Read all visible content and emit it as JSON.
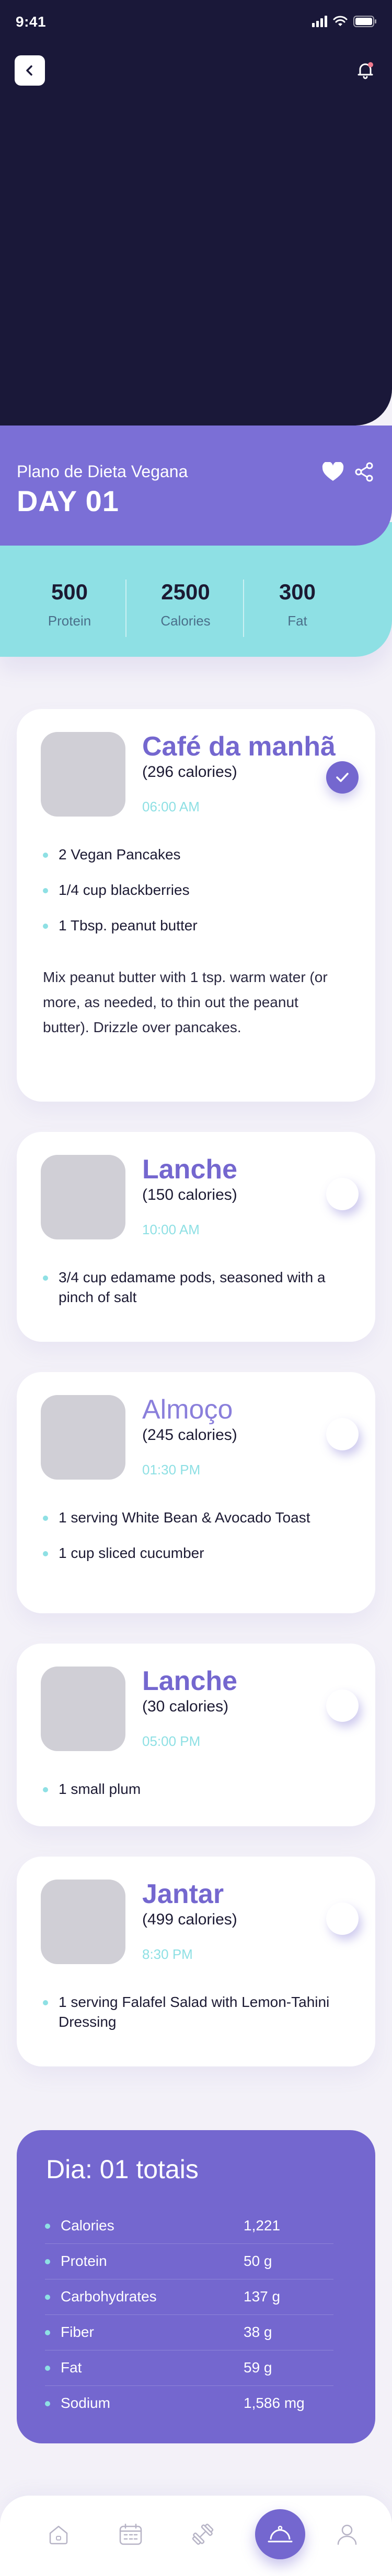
{
  "status_bar": {
    "time": "9:41"
  },
  "plan": {
    "subtitle": "Plano de Dieta Vegana",
    "day": "DAY 01"
  },
  "stats": [
    {
      "value": "500",
      "label": "Protein"
    },
    {
      "value": "2500",
      "label": "Calories"
    },
    {
      "value": "300",
      "label": "Fat"
    }
  ],
  "meals": [
    {
      "name": "Café da manhã",
      "calories": "(296 calories)",
      "time": "06:00 AM",
      "checked": true,
      "items": [
        "2 Vegan Pancakes",
        "1/4 cup blackberries",
        "1 Tbsp. peanut butter"
      ],
      "note": "Mix peanut butter with 1 tsp. warm water (or more, as needed, to thin out the peanut butter). Drizzle over pancakes."
    },
    {
      "name": "Lanche",
      "calories": "(150 calories)",
      "time": "10:00 AM",
      "checked": false,
      "items": [
        "3/4 cup edamame pods, seasoned with a pinch of salt"
      ]
    },
    {
      "name": "Almoço",
      "calories": "(245 calories)",
      "time": "01:30 PM",
      "checked": false,
      "items": [
        "1 serving White Bean & Avocado Toast",
        "1 cup sliced cucumber"
      ]
    },
    {
      "name": "Lanche",
      "calories": "(30 calories)",
      "time": "05:00 PM",
      "checked": false,
      "items": [
        "1 small plum"
      ]
    },
    {
      "name": "Jantar",
      "calories": "(499 calories)",
      "time": "8:30 PM",
      "checked": false,
      "items": [
        "1 serving Falafel Salad with Lemon-Tahini Dressing"
      ]
    }
  ],
  "totals": {
    "title": "Dia: 01 totais",
    "rows": [
      {
        "label": "Calories",
        "value": "1,221"
      },
      {
        "label": "Protein",
        "value": "50 g"
      },
      {
        "label": "Carbohydrates",
        "value": "137 g"
      },
      {
        "label": "Fiber",
        "value": "38 g"
      },
      {
        "label": "Fat",
        "value": "59 g"
      },
      {
        "label": "Sodium",
        "value": "1,586 mg"
      }
    ]
  },
  "colors": {
    "hero": "#1a1839",
    "accent": "#7467cf",
    "band": "#7b6fd6",
    "teal": "#8ee0e4"
  },
  "tabbar": {
    "icons": [
      "home-icon",
      "calendar-icon",
      "dumbbell-icon",
      "meal-cloche-icon",
      "profile-icon"
    ],
    "active": "meal-cloche-icon"
  }
}
